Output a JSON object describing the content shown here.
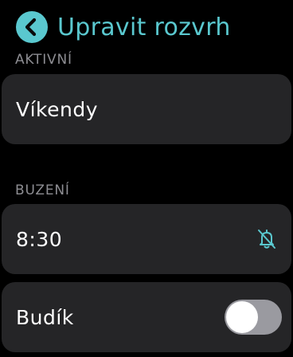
{
  "header": {
    "title": "Upravit rozvrh",
    "back_icon": "chevron-left-icon"
  },
  "colors": {
    "accent": "#5ac8cf",
    "card_background": "#252527",
    "section_label": "#8d8d92",
    "toggle_off": "#9a9aa0"
  },
  "active_section": {
    "label": "AKTIVNÍ",
    "value": "Víkendy"
  },
  "wake_section": {
    "label": "BUZENÍ",
    "time": "8:30",
    "alarm_icon": "bell-slash-icon"
  },
  "alarm_row": {
    "label": "Budík",
    "toggle_on": false
  }
}
